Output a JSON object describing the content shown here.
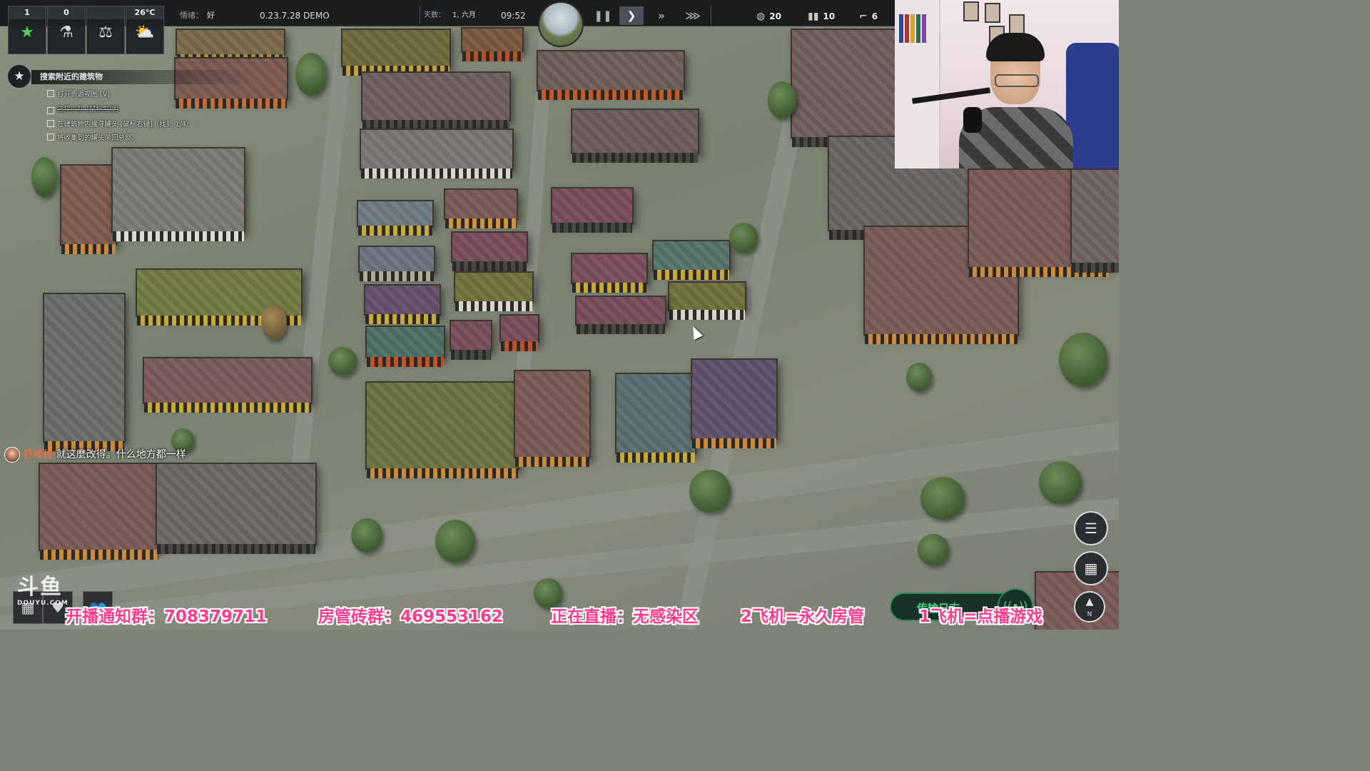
{
  "game": {
    "resources": [
      {
        "value": "1",
        "icon": "star-icon"
      },
      {
        "value": "0",
        "icon": "flask-icon"
      },
      {
        "value": "",
        "icon": "balance-scale-icon"
      },
      {
        "value": "26°C",
        "icon": "weather-icon"
      }
    ],
    "mood_label": "情绪：",
    "mood_value": "好",
    "version": "0.23.7.28 DEMO",
    "day_label": "天数：",
    "day_value": "1, 六月",
    "time": "09:52",
    "speed_controls": [
      "pause",
      "play",
      "fast",
      "fastest"
    ],
    "active_speed": "play",
    "stats": [
      {
        "icon": "food-icon",
        "value": "20"
      },
      {
        "icon": "ammo-icon",
        "value": "10"
      },
      {
        "icon": "gun-icon",
        "value": "6"
      }
    ]
  },
  "objectives": {
    "title": "搜索附近的建筑物",
    "items": [
      {
        "text": "打开资源视图 [V]",
        "done": false
      },
      {
        "text": "选择小队 [鼠标左键]",
        "done": true
      },
      {
        "text": "在建筑物内搜寻罐头 [鼠标右键]（找到 1/4）",
        "done": false
      },
      {
        "text": "将收集到的罐头带回总部。",
        "done": false
      }
    ]
  },
  "chat": {
    "user": "舒稚稚:",
    "message": "就这麼改得。什么地方都一样"
  },
  "controls": {
    "layers_icon": "layers-icon",
    "grid_icon": "grid-icon",
    "compass_icon": "compass-icon",
    "compass_label": "N"
  },
  "log_button": {
    "label": "传输日志",
    "icon": "radio-icon"
  },
  "watermark": {
    "logo": "斗鱼",
    "domain": "DOUYU.COM"
  },
  "overlay": [
    "开播通知群：708379711",
    "房管砖群：469553162",
    "正在直播：无感染区",
    "2飞机=永久房管",
    "1飞机=点播游戏"
  ]
}
